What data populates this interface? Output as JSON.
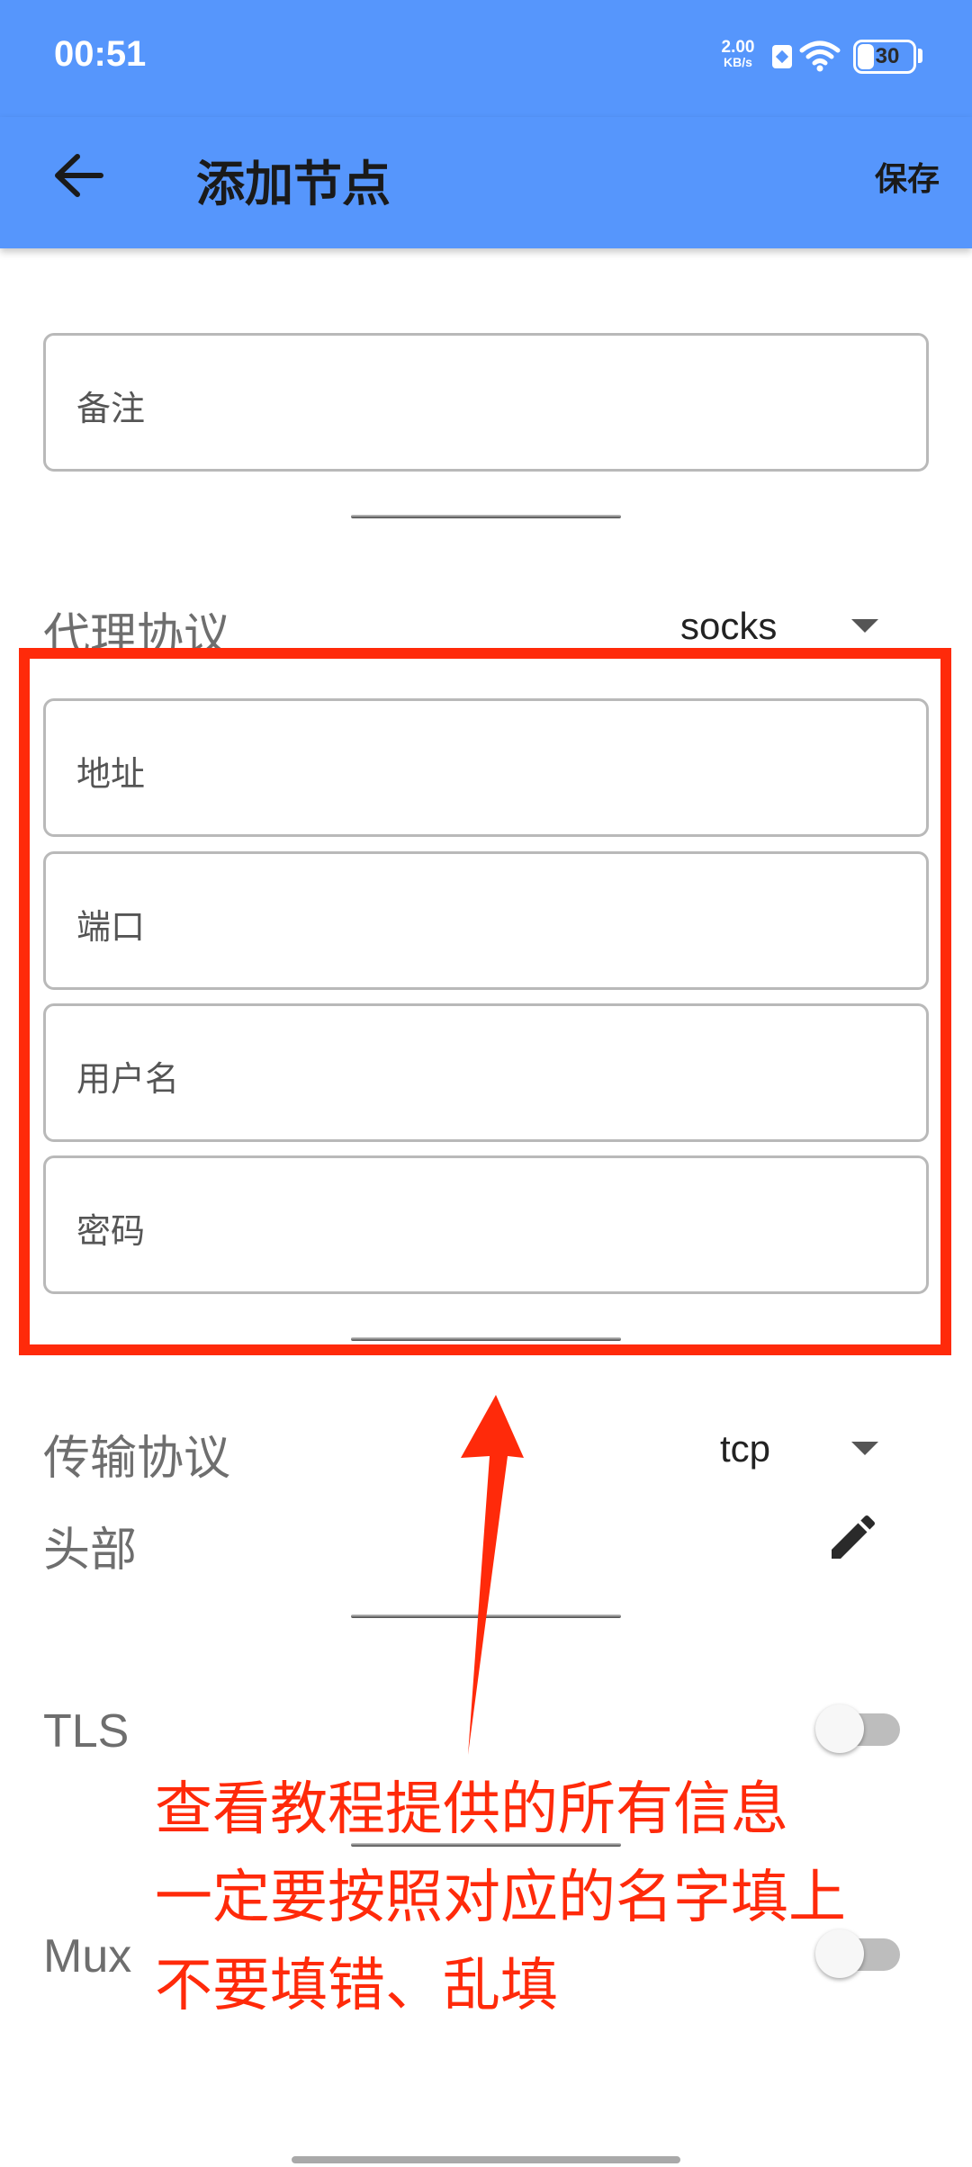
{
  "status_bar": {
    "time": "00:51",
    "net_speed_value": "2.00",
    "net_speed_unit": "KB/s",
    "battery_level": "30",
    "battery_percent": 30
  },
  "app_bar": {
    "title": "添加节点",
    "save_label": "保存"
  },
  "form": {
    "remarks_placeholder": "备注",
    "proxy_protocol_label": "代理协议",
    "proxy_protocol_value": "socks",
    "address_placeholder": "地址",
    "port_placeholder": "端口",
    "username_placeholder": "用户名",
    "password_placeholder": "密码",
    "transport_protocol_label": "传输协议",
    "transport_protocol_value": "tcp",
    "header_label": "头部",
    "tls_label": "TLS",
    "tls_enabled": false,
    "mux_label": "Mux",
    "mux_enabled": false
  },
  "annotation": {
    "line1": "查看教程提供的所有信息",
    "line2": "一定要按照对应的名字填上",
    "line3": "不要填错、乱填"
  },
  "colors": {
    "primary": "#5696fc",
    "annotation_red": "#ff2a0a",
    "field_border": "#b9b9b9"
  },
  "icons": {
    "back": "arrow-left-icon",
    "edit": "pencil-icon",
    "dropdown": "triangle-down-icon"
  }
}
